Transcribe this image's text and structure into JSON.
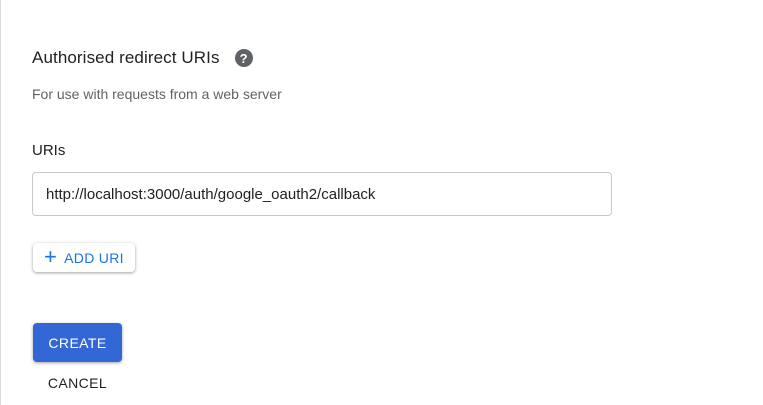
{
  "section": {
    "title": "Authorised redirect URIs",
    "help_icon": "?",
    "description": "For use with requests from a web server"
  },
  "uris_field": {
    "label": "URIs",
    "value": "http://localhost:3000/auth/google_oauth2/callback"
  },
  "add_uri": {
    "icon": "+",
    "label": "ADD URI"
  },
  "actions": {
    "create_label": "CREATE",
    "cancel_label": "CANCEL"
  },
  "colors": {
    "primary": "#3367d6",
    "link": "#1a73e8",
    "text": "#202124",
    "muted": "#5f6368",
    "border": "#c5c9ce"
  }
}
